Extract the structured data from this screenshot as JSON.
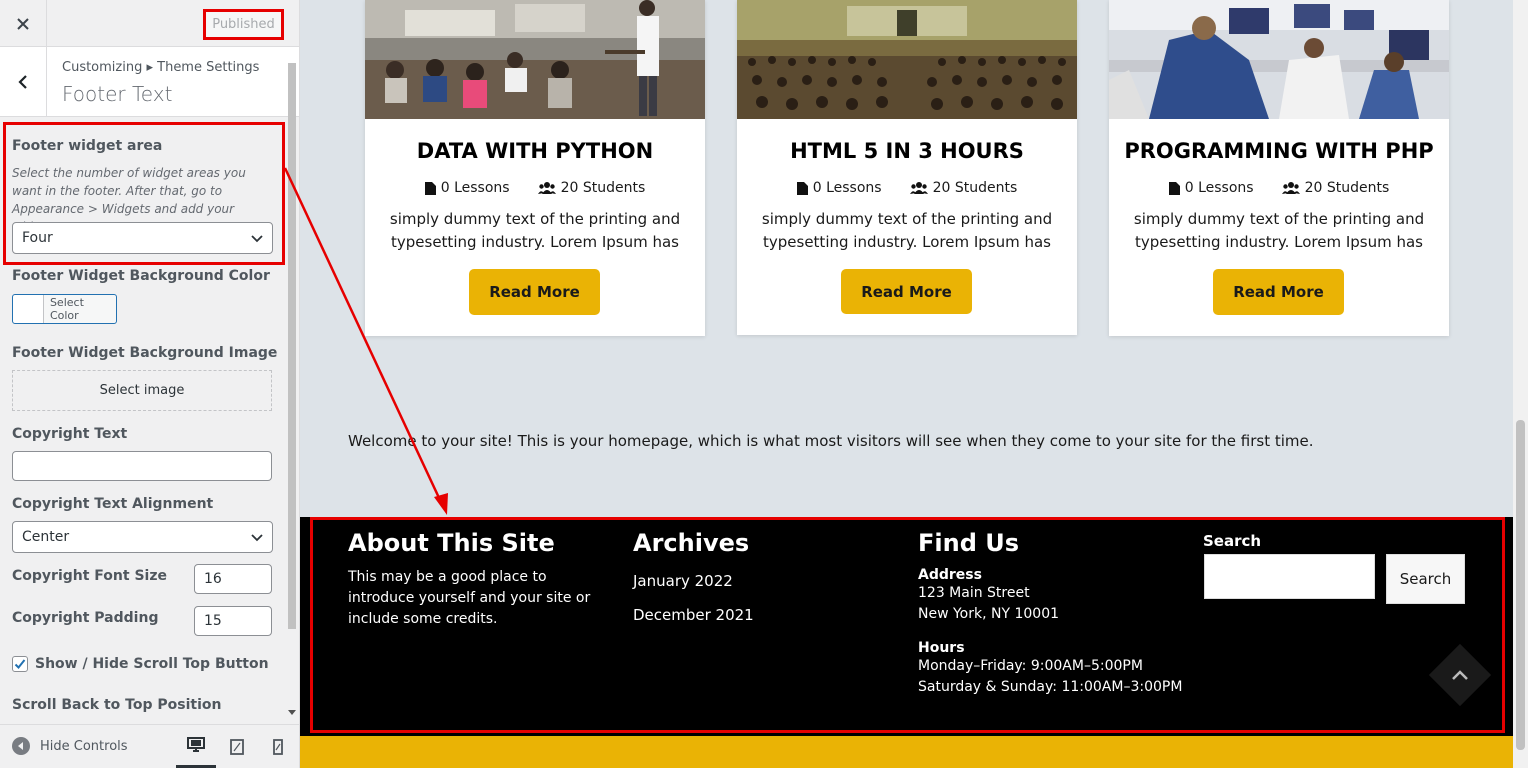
{
  "sidebar": {
    "close_icon": "close-icon",
    "publish_label": "Published",
    "breadcrumb": "Customizing ▸ Theme Settings",
    "section_title": "Footer Text",
    "controls": {
      "widget_area_label": "Footer widget area",
      "widget_area_desc": "Select the number of widget areas you want in the footer. After that, go to Appearance > Widgets and add your widgets.",
      "widget_area_value": "Four",
      "bg_color_label": "Footer Widget Background Color",
      "select_color_label": "Select Color",
      "bg_image_label": "Footer Widget Background Image",
      "select_image_label": "Select image",
      "copyright_text_label": "Copyright Text",
      "copyright_text_value": "",
      "copyright_align_label": "Copyright Text Alignment",
      "copyright_align_value": "Center",
      "copyright_font_size_label": "Copyright Font Size",
      "copyright_font_size_value": "16",
      "copyright_padding_label": "Copyright Padding",
      "copyright_padding_value": "15",
      "scroll_top_label": "Show / Hide Scroll Top Button",
      "scroll_top_checked": true,
      "scroll_position_label": "Scroll Back to Top Position"
    },
    "footer": {
      "hide_controls_label": "Hide Controls",
      "devices": [
        "desktop",
        "tablet",
        "mobile"
      ],
      "active_device": "desktop"
    }
  },
  "preview": {
    "courses": [
      {
        "title": "DATA WITH PYTHON",
        "lessons": "0 Lessons",
        "students": "20 Students",
        "desc": "simply dummy text of the printing and typesetting industry. Lorem Ipsum has",
        "button": "Read More"
      },
      {
        "title": "HTML 5 IN 3 HOURS",
        "lessons": "0 Lessons",
        "students": "20 Students",
        "desc": "simply dummy text of the printing and typesetting industry. Lorem Ipsum has",
        "button": "Read More"
      },
      {
        "title": "PROGRAMMING WITH PHP",
        "lessons": "0 Lessons",
        "students": "20 Students",
        "desc": "simply dummy text of the printing and typesetting industry. Lorem Ipsum has",
        "button": "Read More"
      }
    ],
    "welcome": "Welcome to your site! This is your homepage, which is what most visitors will see when they come to your site for the first time.",
    "footer": {
      "about": {
        "title": "About This Site",
        "text": "This may be a good place to introduce yourself and your site or include some credits."
      },
      "archives": {
        "title": "Archives",
        "items": [
          "January 2022",
          "December 2021"
        ]
      },
      "find_us": {
        "title": "Find Us",
        "address_label": "Address",
        "address_line1": "123 Main Street",
        "address_line2": "New York, NY 10001",
        "hours_label": "Hours",
        "hours_line1": "Monday–Friday: 9:00AM–5:00PM",
        "hours_line2": "Saturday & Sunday: 11:00AM–3:00PM"
      },
      "search": {
        "label": "Search",
        "button": "Search",
        "value": ""
      }
    }
  },
  "colors": {
    "accent_yellow": "#eab305",
    "highlight_red": "#e60000",
    "footer_bg": "#000000",
    "preview_bg": "#dde3e8"
  }
}
